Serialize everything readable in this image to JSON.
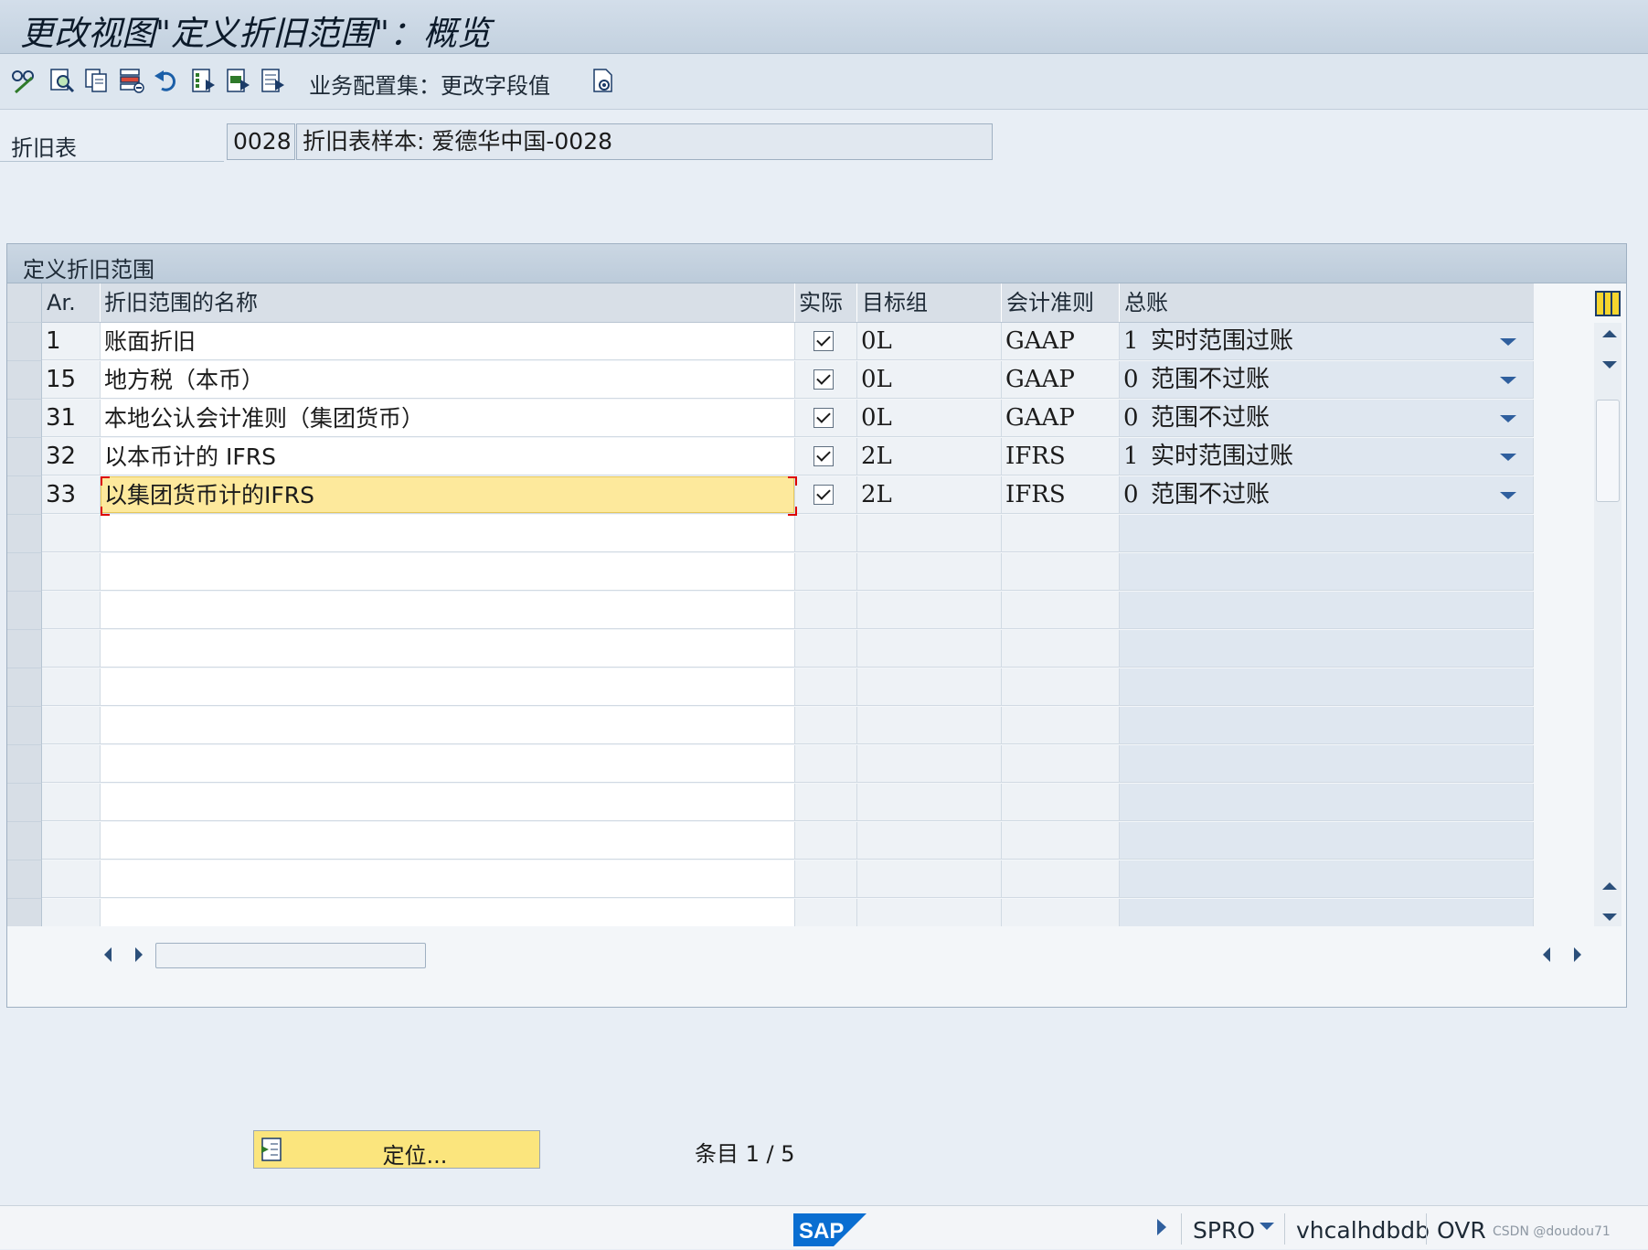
{
  "window": {
    "title": "更改视图\"定义折旧范围\"：概览"
  },
  "toolbar": {
    "icons": [
      "edit-glasses-icon",
      "search-details-icon",
      "copy-icon",
      "delete-icon",
      "undo-icon",
      "select-all-icon",
      "select-block-icon",
      "deselect-all-icon",
      "configure-icon"
    ],
    "label": "业务配置集：更改字段值"
  },
  "header": {
    "chart_of_depreciation_label": "折旧表",
    "chart_of_depreciation_code": "0028",
    "chart_of_depreciation_desc": "折旧表样本: 爱德华中国-0028"
  },
  "panel": {
    "title": "定义折旧范围",
    "columns": {
      "area": "Ar.",
      "name": "折旧范围的名称",
      "actual": "实际",
      "target_group": "目标组",
      "accounting_principle": "会计准则",
      "gl": "总账"
    },
    "rows": [
      {
        "area": "1",
        "name": "账面折旧",
        "actual": true,
        "target_group": "0L",
        "accounting_principle": "GAAP",
        "gl_code": "1",
        "gl_text": "实时范围过账"
      },
      {
        "area": "15",
        "name": "地方税（本币）",
        "actual": true,
        "target_group": "0L",
        "accounting_principle": "GAAP",
        "gl_code": "0",
        "gl_text": "范围不过账"
      },
      {
        "area": "31",
        "name": "本地公认会计准则（集团货币）",
        "actual": true,
        "target_group": "0L",
        "accounting_principle": "GAAP",
        "gl_code": "0",
        "gl_text": "范围不过账"
      },
      {
        "area": "32",
        "name": "以本币计的 IFRS",
        "actual": true,
        "target_group": "2L",
        "accounting_principle": "IFRS",
        "gl_code": "1",
        "gl_text": "实时范围过账"
      },
      {
        "area": "33",
        "name": "以集团货币计的IFRS",
        "actual": true,
        "target_group": "2L",
        "accounting_principle": "IFRS",
        "gl_code": "0",
        "gl_text": "范围不过账"
      }
    ],
    "empty_rows": 12,
    "focused_row_index": 4
  },
  "footer": {
    "position_button_label": "定位...",
    "entry_info": "条目 1 / 5"
  },
  "status_bar": {
    "logo": "SAP",
    "transaction": "SPRO",
    "server": "vhcalhdbdb",
    "mode": "OVR",
    "watermark": "CSDN @doudou71"
  },
  "colors": {
    "accent": "#2f5f9e",
    "focus_row": "#fde99c",
    "button_yellow": "#fbe57d",
    "sap_blue": "#0a6ed1"
  }
}
